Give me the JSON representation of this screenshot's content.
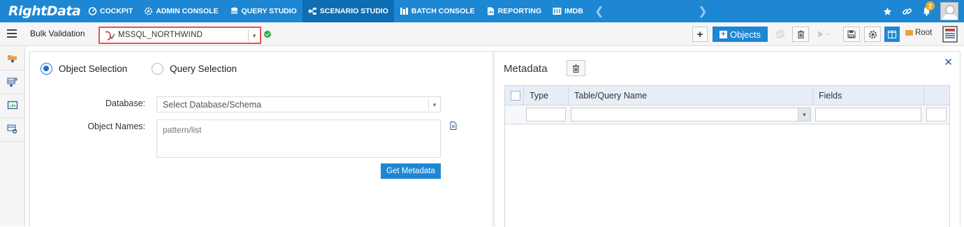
{
  "nav": {
    "logo": "RightData",
    "items": [
      {
        "label": "COCKPIT",
        "icon": "cockpit-icon"
      },
      {
        "label": "ADMIN CONSOLE",
        "icon": "gear-icon"
      },
      {
        "label": "QUERY STUDIO",
        "icon": "database-icon"
      },
      {
        "label": "SCENARIO STUDIO",
        "icon": "scenario-icon",
        "active": true
      },
      {
        "label": "BATCH CONSOLE",
        "icon": "batch-icon"
      },
      {
        "label": "REPORTING",
        "icon": "report-icon"
      },
      {
        "label": "IMDB",
        "icon": "imdb-icon"
      }
    ],
    "notification_count": "2",
    "accent_color": "#1d87d4"
  },
  "toolbar": {
    "title": "Bulk Validation",
    "connection": "MSSQL_NORTHWIND",
    "objects_label": "Objects",
    "root_label": "Root"
  },
  "left": {
    "radio_object": "Object Selection",
    "radio_query": "Query Selection",
    "database_label": "Database:",
    "database_placeholder": "Select Database/Schema",
    "objects_label": "Object Names:",
    "objects_placeholder": "pattern/list",
    "get_metadata": "Get Metadata"
  },
  "right": {
    "title": "Metadata",
    "columns": [
      "Type",
      "Table/Query Name",
      "Fields"
    ]
  }
}
